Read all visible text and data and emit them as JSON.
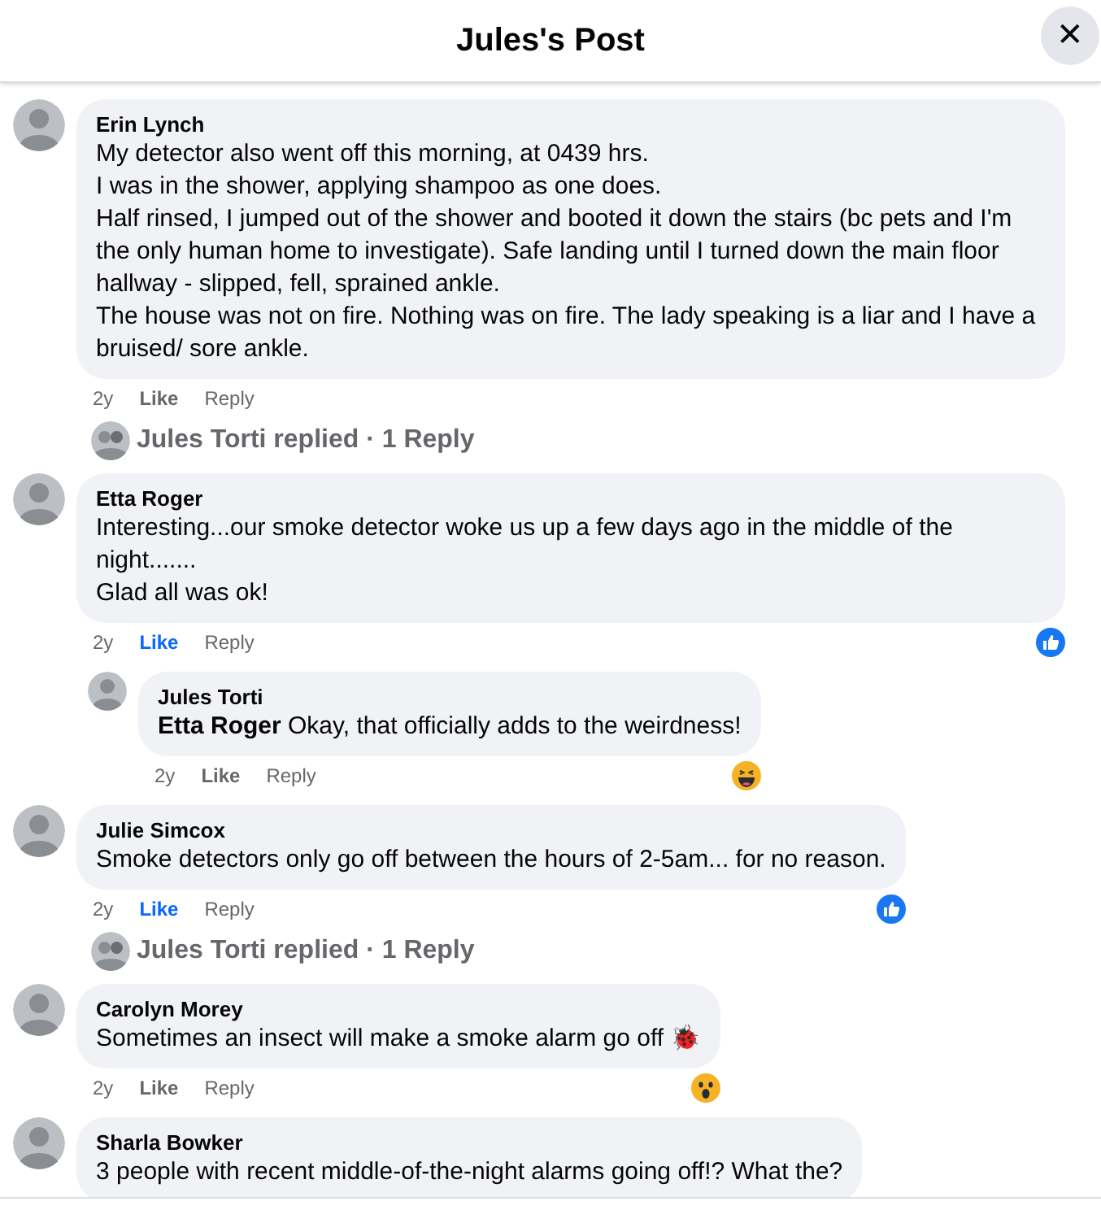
{
  "header": {
    "title": "Jules's Post",
    "close": "✕"
  },
  "comments": [
    {
      "author": "Erin Lynch",
      "paragraphs": [
        "My detector also went off this morning, at 0439 hrs.",
        "I was in the shower, applying shampoo as one does.",
        "Half rinsed, I jumped out of the shower and booted it down the stairs (bc pets and I'm the only human home to investigate). Safe landing until I turned down the main floor hallway - slipped, fell, sprained ankle.",
        "The house was not on fire. Nothing was on fire. The lady speaking is a liar and I have a bruised/ sore ankle."
      ],
      "age": "2y",
      "like": "Like",
      "liked": false,
      "reply": "Reply",
      "replies_link": "Jules Torti replied · 1 Reply"
    },
    {
      "author": "Etta Roger",
      "paragraphs": [
        "Interesting...our smoke detector woke us up a few days ago in the middle of the night.......",
        "Glad all was ok!"
      ],
      "age": "2y",
      "like": "Like",
      "liked": true,
      "reply": "Reply",
      "reaction": {
        "kind": "like"
      },
      "replies": [
        {
          "author": "Jules Torti",
          "paragraphs": [
            "**Etta Roger** Okay, that officially adds to the weirdness!"
          ],
          "age": "2y",
          "like": "Like",
          "liked": false,
          "reply": "Reply",
          "reaction": {
            "kind": "haha"
          }
        }
      ]
    },
    {
      "author": "Julie Simcox",
      "paragraphs": [
        "Smoke detectors only go off between the hours of 2-5am... for no reason."
      ],
      "age": "2y",
      "like": "Like",
      "liked": true,
      "reply": "Reply",
      "reaction": {
        "kind": "like"
      },
      "replies_link": "Jules Torti replied · 1 Reply"
    },
    {
      "author": "Carolyn Morey",
      "paragraphs": [
        "Sometimes an insect will make a smoke alarm go off 🐞"
      ],
      "age": "2y",
      "like": "Like",
      "liked": false,
      "reply": "Reply",
      "reaction": {
        "kind": "wow"
      }
    },
    {
      "author": "Sharla Bowker",
      "paragraphs": [
        "3 people with recent middle-of-the-night alarms going off!? What the?"
      ]
    }
  ]
}
